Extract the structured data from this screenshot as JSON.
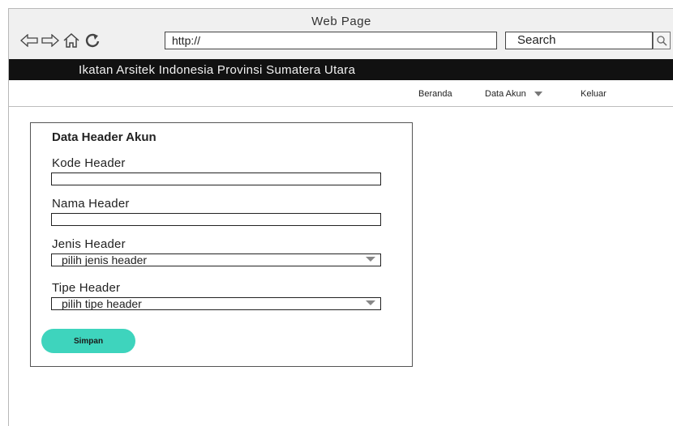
{
  "window": {
    "title": "Web Page"
  },
  "browser": {
    "url": "http://",
    "search_label": "Search",
    "nav_icons": [
      "back-arrow-icon",
      "forward-arrow-icon",
      "home-icon",
      "refresh-icon"
    ]
  },
  "site": {
    "brand": "Ikatan Arsitek Indonesia Provinsi Sumatera Utara"
  },
  "menu": {
    "items": [
      {
        "label": "Beranda"
      },
      {
        "label": "Data Akun",
        "has_dropdown": true
      },
      {
        "label": "Keluar"
      }
    ]
  },
  "form": {
    "title": "Data Header Akun",
    "fields": [
      {
        "label": "Kode Header",
        "type": "text",
        "value": ""
      },
      {
        "label": "Nama Header",
        "type": "text",
        "value": ""
      },
      {
        "label": "Jenis Header",
        "type": "select",
        "selected": "pilih jenis header"
      },
      {
        "label": "Tipe Header",
        "type": "select",
        "selected": "pilih tipe header"
      }
    ],
    "submit_label": "Simpan"
  },
  "colors": {
    "brand_bar": "#111111",
    "submit_button": "#3ed4bd"
  }
}
